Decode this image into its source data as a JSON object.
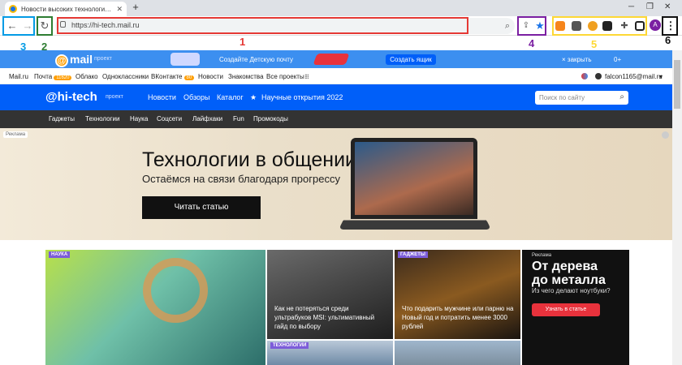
{
  "browser": {
    "tab_title": "Новости высоких технологий, с",
    "tab_close": "✕",
    "new_tab": "+",
    "url": "https://hi-tech.mail.ru",
    "avatar_letter": "A",
    "menu_glyph": "⋮"
  },
  "annotations": {
    "labels": [
      "1",
      "2",
      "3",
      "4",
      "5",
      "6"
    ],
    "colors": {
      "1": "#e53935",
      "2": "#2e7d32",
      "3": "#039be5",
      "4": "#7b1fa2",
      "5": "#fdd835",
      "6": "#111111"
    }
  },
  "mailbar": {
    "logo": "mail",
    "project_label": "проект",
    "promo_text": "Создайте Детскую почту",
    "create_button": "Создать ящик",
    "close_link": "× закрыть",
    "age": "0+"
  },
  "portal_nav": {
    "items": [
      "Mail.ru",
      "Почта",
      "Облако",
      "Одноклассники",
      "ВКонтакте",
      "Новости",
      "Знакомства",
      "Все проекты"
    ],
    "mail_badge": "11620",
    "vk_badge": "80",
    "user": "falcon1165@mail.ru"
  },
  "site_header": {
    "logo": "hi-tech",
    "project_label": "проект",
    "nav": [
      "Новости",
      "Обзоры",
      "Каталог",
      "Научные открытия 2022"
    ],
    "search_placeholder": "Поиск по сайту"
  },
  "categories": [
    "Гаджеты",
    "Технологии",
    "Наука",
    "Соцсети",
    "Лайфхаки",
    "Fun",
    "Промокоды"
  ],
  "hero": {
    "ad_label": "Реклама",
    "title": "Технологии в общении",
    "subtitle": "Остаёмся на связи благодаря прогрессу",
    "button": "Читать статью"
  },
  "cards": [
    {
      "tag": "НАУКА",
      "title": ""
    },
    {
      "tag": "",
      "title": "Как не потеряться среди ультрабуков MSI: ультимативный гайд по выбору"
    },
    {
      "tag": "ГАДЖЕТЫ",
      "title": "Что подарить мужчине или парню на Новый год и потратить менее 3000 рублей"
    },
    {
      "tag": "ТЕХНОЛОГИИ",
      "title": ""
    }
  ],
  "ad_card": {
    "label": "Реклама",
    "title_line1": "От дерева",
    "title_line2": "до металла",
    "subtitle": "Из чего делают ноутбуки?",
    "button": "Узнать в статье"
  }
}
